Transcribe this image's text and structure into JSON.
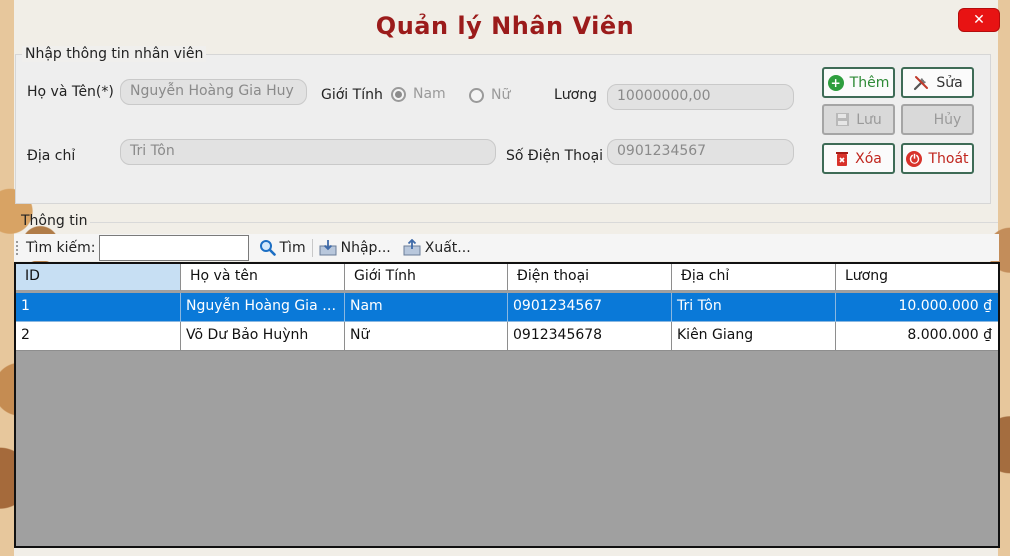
{
  "window": {
    "title": "Quản lý Nhân Viên",
    "close_label": "✕"
  },
  "input_group": {
    "legend": "Nhập thông tin nhân viên",
    "name_label": "Họ và Tên(*)",
    "name_value": "Nguyễn Hoàng Gia Huy",
    "gender_label": "Giới Tính",
    "gender_options": [
      "Nam",
      "Nữ"
    ],
    "gender_selected": "Nam",
    "salary_label": "Lương",
    "salary_value": "10000000,00",
    "address_label": "Địa chỉ",
    "address_value": "Tri Tôn",
    "phone_label": "Số Điện Thoại",
    "phone_value": "0901234567"
  },
  "actions": {
    "add": "Thêm",
    "edit": "Sửa",
    "save": "Lưu",
    "cancel": "Hủy",
    "delete": "Xóa",
    "exit": "Thoát"
  },
  "info": {
    "legend": "Thông tin",
    "search_label": "Tìm kiếm:",
    "search_value": "",
    "find": "Tìm",
    "import": "Nhập...",
    "export": "Xuất..."
  },
  "table": {
    "columns": [
      "ID",
      "Họ và tên",
      "Giới Tính",
      "Điện thoại",
      "Địa chỉ",
      "Lương"
    ],
    "rows": [
      [
        "1",
        "Nguyễn Hoàng Gia H...",
        "Nam",
        "0901234567",
        "Tri Tôn",
        "10.000.000 ₫"
      ],
      [
        "2",
        "Võ Dư Bảo Huỳnh",
        "Nữ",
        "0912345678",
        "Kiên Giang",
        "8.000.000 ₫"
      ]
    ],
    "selected_row": 0
  },
  "colors": {
    "title": "#9b1b1b",
    "close": "#e81313",
    "selection": "#0a79d8",
    "add_icon": "#2e9e3e",
    "delete_icon": "#d8322a",
    "exit_icon": "#d8322a"
  }
}
